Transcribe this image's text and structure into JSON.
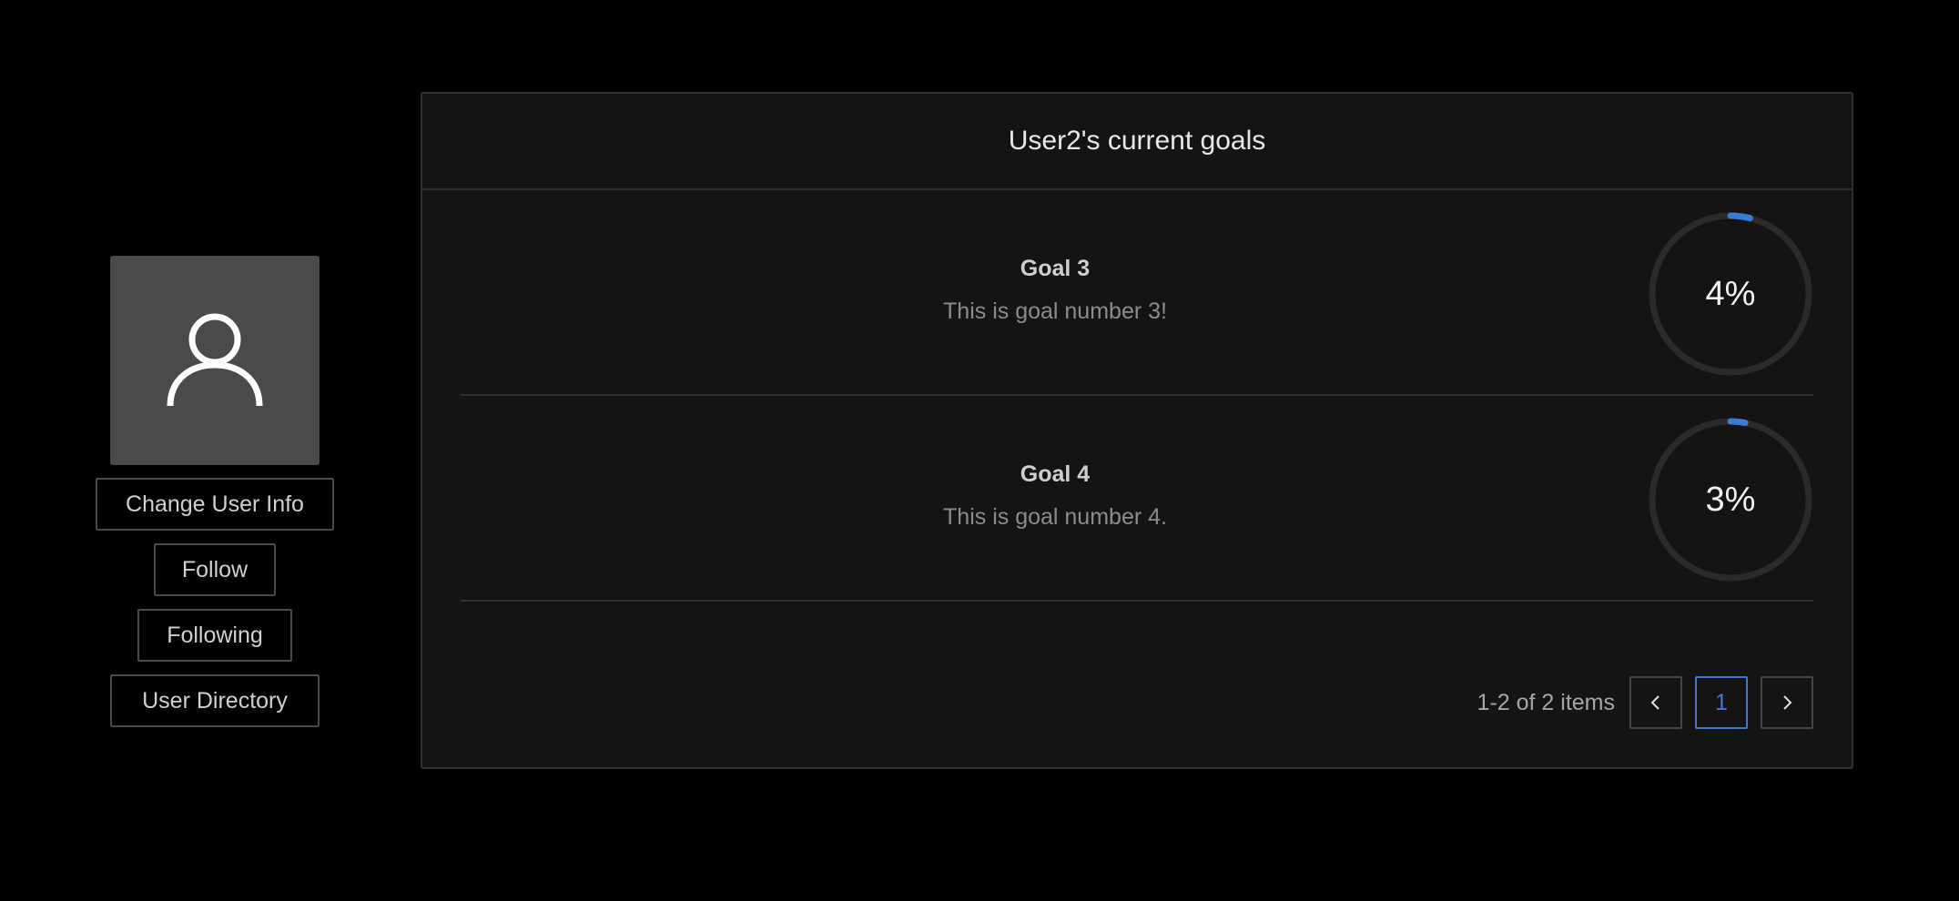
{
  "sidebar": {
    "avatar_icon": "user-icon",
    "buttons": {
      "change_user_info": "Change User Info",
      "follow": "Follow",
      "following": "Following",
      "user_directory": "User Directory"
    }
  },
  "goals_card": {
    "title": "User2's current goals",
    "goals": [
      {
        "title": "Goal 3",
        "description": "This is goal number 3!",
        "percent": 4,
        "percent_label": "4%"
      },
      {
        "title": "Goal 4",
        "description": "This is goal number 4.",
        "percent": 3,
        "percent_label": "3%"
      }
    ]
  },
  "pagination": {
    "summary": "1-2 of 2 items",
    "current_page": "1",
    "prev_icon": "chevron-left-icon",
    "next_icon": "chevron-right-icon"
  },
  "colors": {
    "background": "#000000",
    "card": "#141414",
    "border": "#303030",
    "accent": "#3a7bd5",
    "avatar_bg": "#4a4a4a",
    "progress_track": "#2a2a2a"
  }
}
